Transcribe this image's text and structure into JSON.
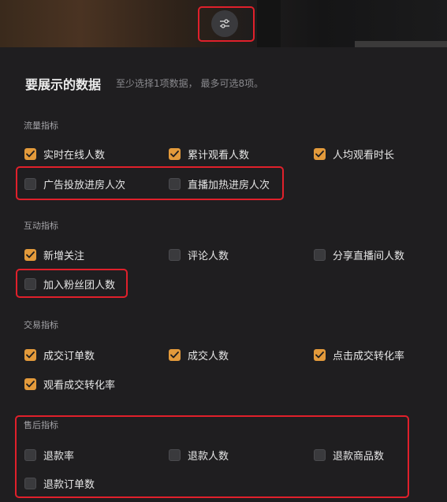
{
  "settings_icon": "sliders-icon",
  "title": "要展示的数据",
  "subtitle": "至少选择1项数据， 最多可选8项。",
  "check_color": "#e39a3b",
  "highlight_color": "#e0202b",
  "sections": [
    {
      "label": "流量指标",
      "items": [
        {
          "label": "实时在线人数",
          "checked": true
        },
        {
          "label": "累计观看人数",
          "checked": true
        },
        {
          "label": "人均观看时长",
          "checked": true
        },
        {
          "label": "广告投放进房人次",
          "checked": false
        },
        {
          "label": "直播加热进房人次",
          "checked": false
        }
      ]
    },
    {
      "label": "互动指标",
      "items": [
        {
          "label": "新增关注",
          "checked": true
        },
        {
          "label": "评论人数",
          "checked": false
        },
        {
          "label": "分享直播间人数",
          "checked": false
        },
        {
          "label": "加入粉丝团人数",
          "checked": false
        }
      ]
    },
    {
      "label": "交易指标",
      "items": [
        {
          "label": "成交订单数",
          "checked": true
        },
        {
          "label": "成交人数",
          "checked": true
        },
        {
          "label": "点击成交转化率",
          "checked": true
        },
        {
          "label": "观看成交转化率",
          "checked": true
        }
      ]
    },
    {
      "label": "售后指标",
      "items": [
        {
          "label": "退款率",
          "checked": false
        },
        {
          "label": "退款人数",
          "checked": false
        },
        {
          "label": "退款商品数",
          "checked": false
        },
        {
          "label": "退款订单数",
          "checked": false
        }
      ]
    }
  ]
}
